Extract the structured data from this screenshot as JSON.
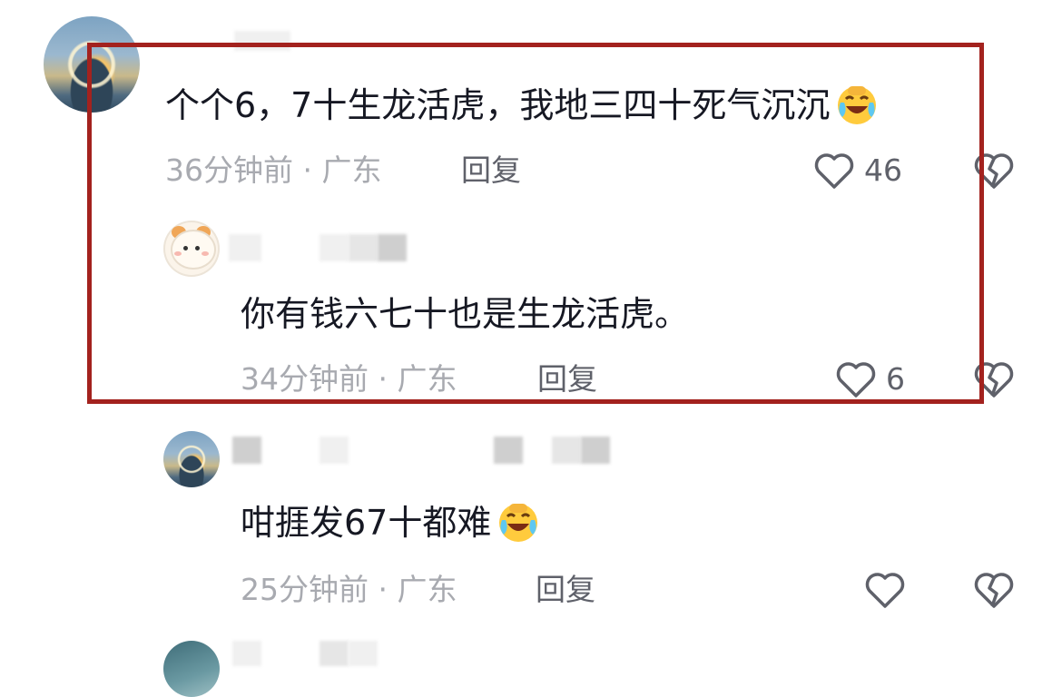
{
  "comments": [
    {
      "text": "个个6，7十生龙活虎，我地三四十死气沉沉",
      "emoji": "laughing-crying-emoji",
      "time_location": "36分钟前 · 广东",
      "reply_label": "回复",
      "likes": "46"
    },
    {
      "text": "你有钱六七十也是生龙活虎。",
      "time_location": "34分钟前 · 广东",
      "reply_label": "回复",
      "likes": "6"
    },
    {
      "text": "咁捱发67十都难",
      "emoji": "laughing-crying-emoji",
      "time_location": "25分钟前 · 广东",
      "reply_label": "回复",
      "likes": ""
    }
  ],
  "icons": {
    "like": "heart-outline-icon",
    "dislike": "broken-heart-outline-icon"
  },
  "colors": {
    "highlight_border": "#a3221e",
    "comment_text": "#161823",
    "meta_text": "#a8aab0",
    "action_text": "#5f616a"
  }
}
